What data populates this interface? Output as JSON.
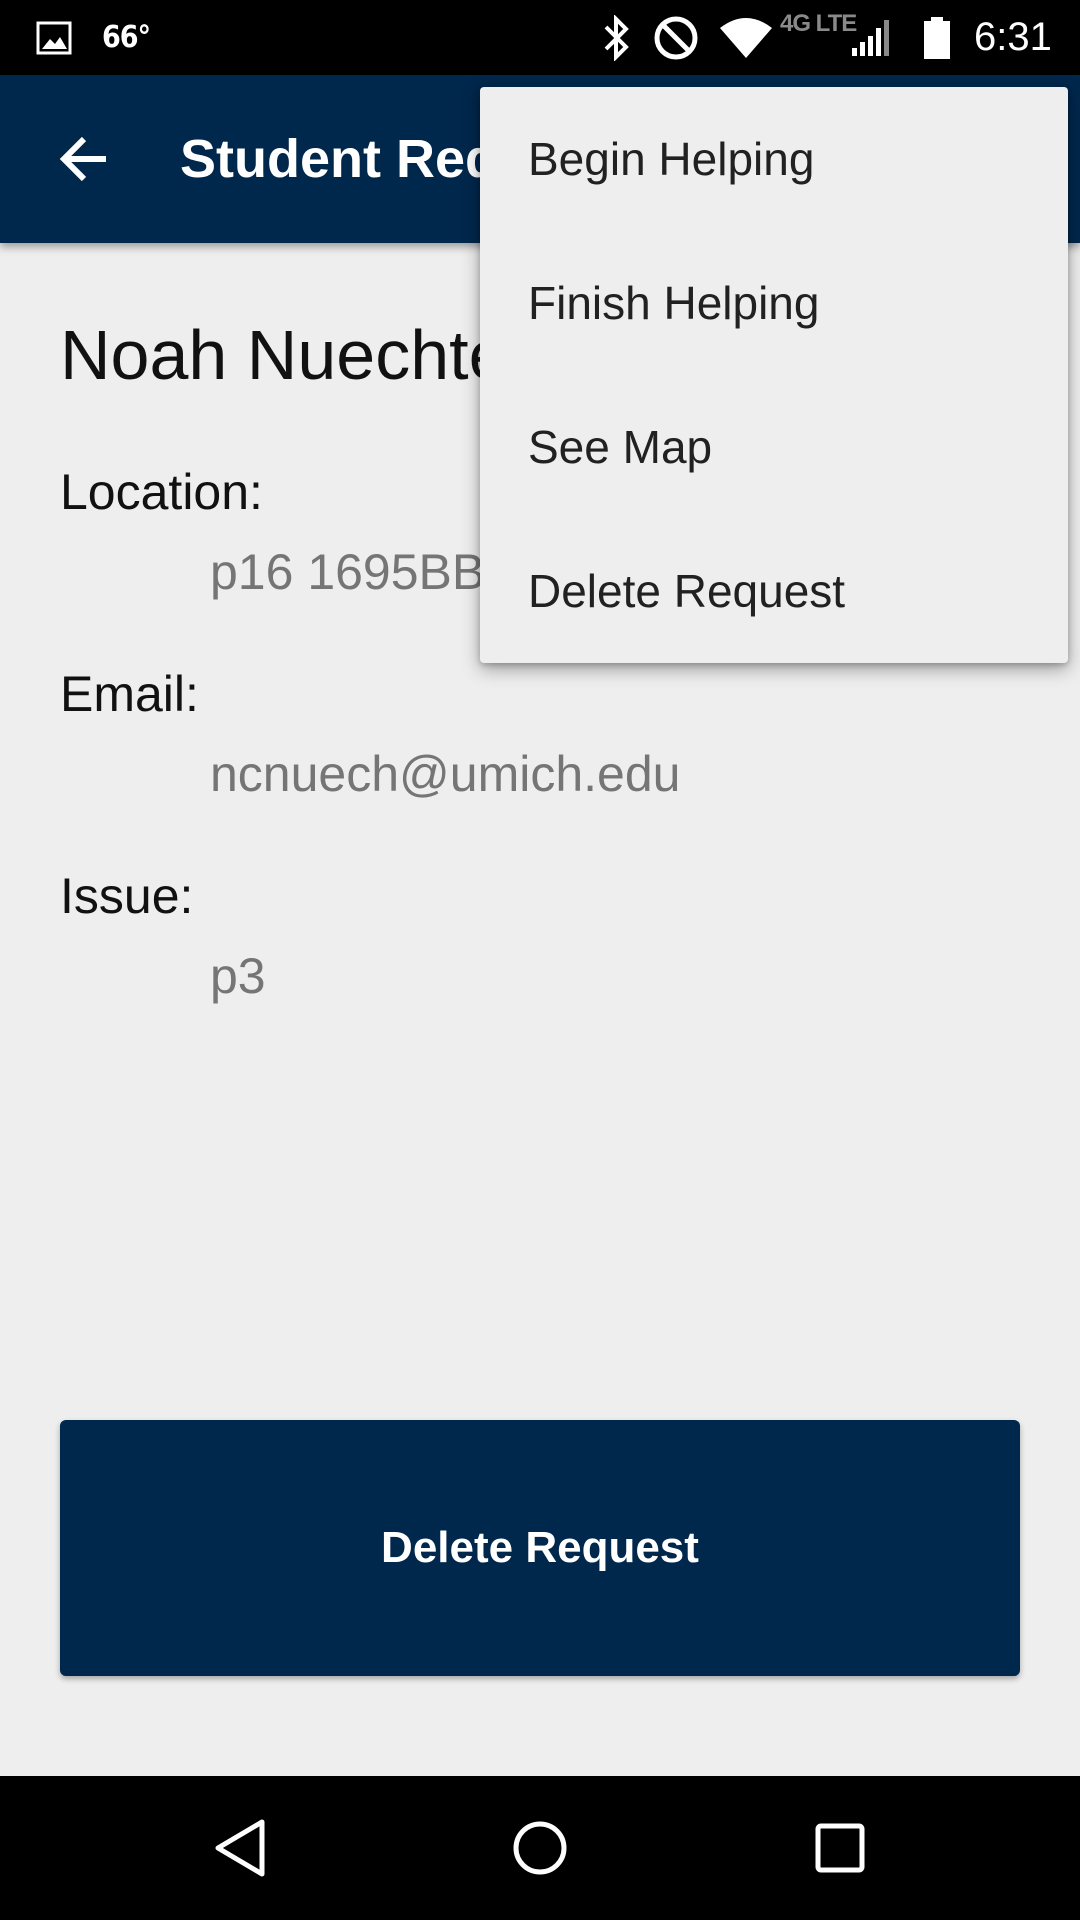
{
  "status_bar": {
    "temperature": "66°",
    "network_type": "4G LTE",
    "time": "6:31",
    "icons": [
      "image-icon",
      "bluetooth-icon",
      "do-not-disturb-icon",
      "wifi-icon",
      "signal-icon",
      "battery-icon"
    ]
  },
  "toolbar": {
    "title": "Student Request",
    "back_icon": "arrow-back-icon"
  },
  "request": {
    "student_name": "Noah Nuechterlein",
    "location_label": "Location:",
    "location_value": "p16 1695BBB",
    "email_label": "Email:",
    "email_value": "ncnuech@umich.edu",
    "issue_label": "Issue:",
    "issue_value": "p3"
  },
  "primary_button": {
    "label": "Delete Request"
  },
  "overflow_menu": {
    "items": [
      {
        "label": "Begin Helping"
      },
      {
        "label": "Finish Helping"
      },
      {
        "label": "See Map"
      },
      {
        "label": "Delete Request"
      }
    ]
  },
  "nav_bar": {
    "icons": [
      "back-triangle-icon",
      "home-circle-icon",
      "recents-square-icon"
    ]
  },
  "colors": {
    "primary": "#00274c",
    "background": "#eeeeee",
    "secondary_text": "#757575"
  }
}
